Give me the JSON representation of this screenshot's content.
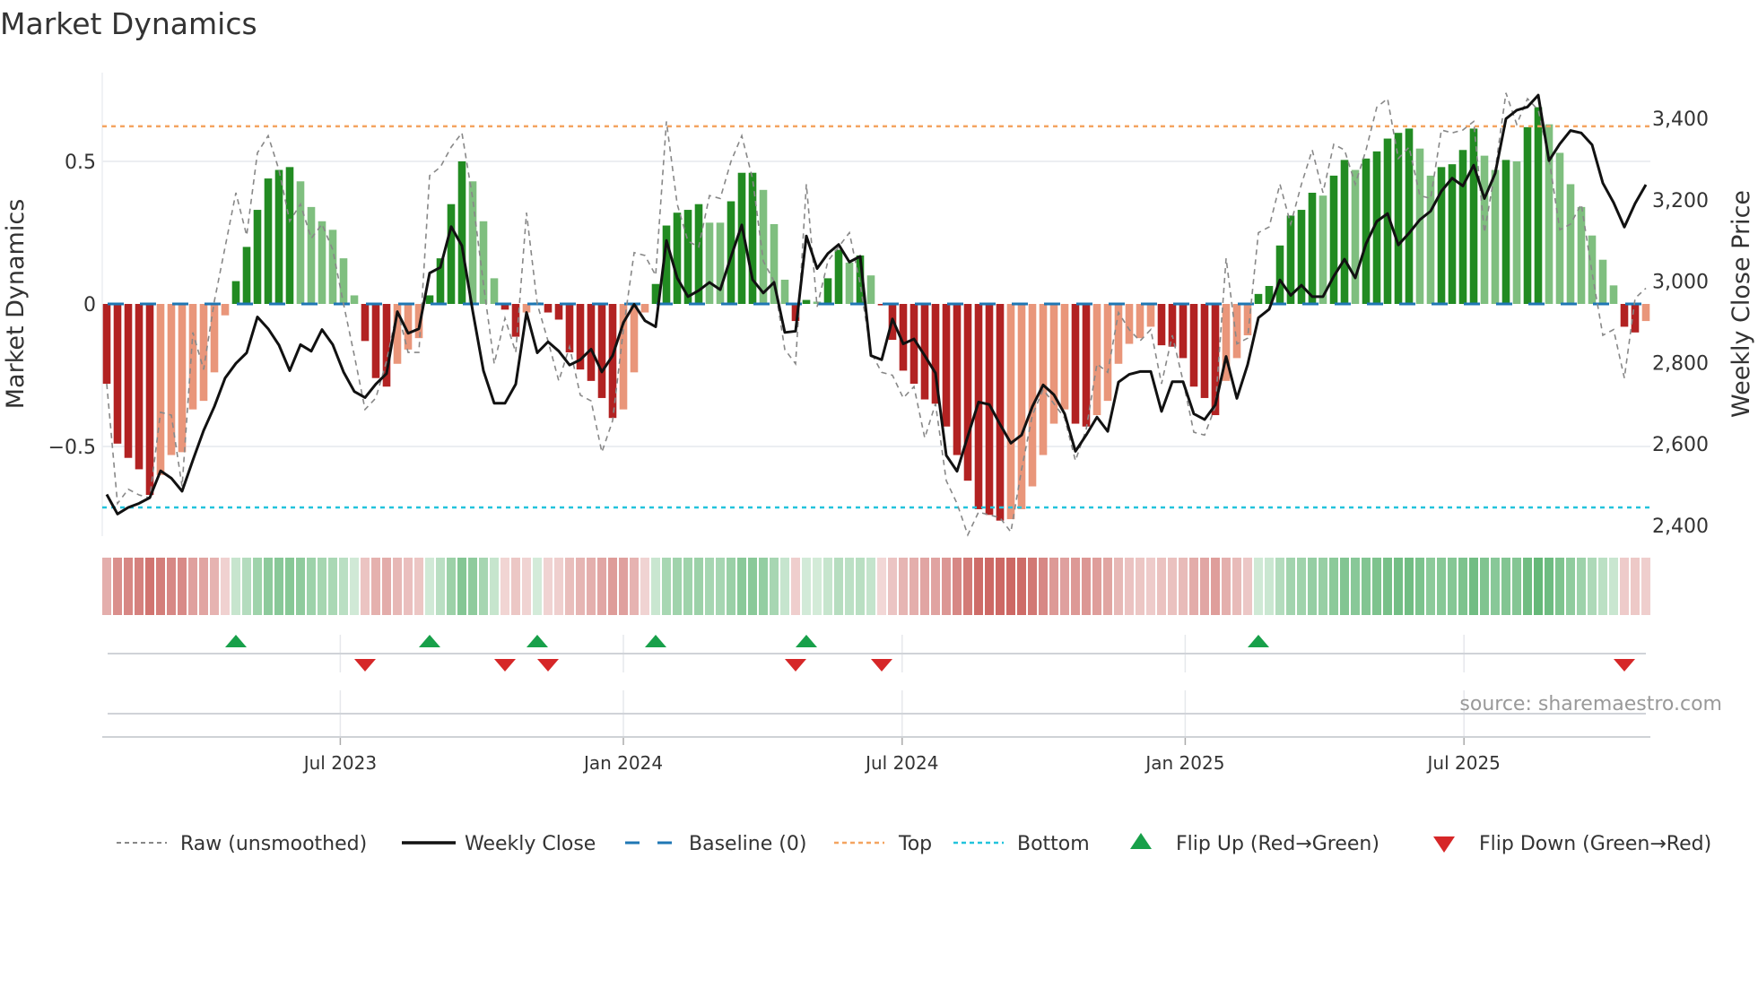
{
  "title": "Market Dynamics",
  "source": "source: sharemaestro.com",
  "chart_data": {
    "type": "bar",
    "title": "Market Dynamics",
    "ylabel": "Market Dynamics",
    "y2label": "Weekly Close Price",
    "ylim": [
      -0.82,
      0.78
    ],
    "y2lim": [
      2380,
      3515
    ],
    "yticks": [
      {
        "v": 0.5,
        "label": "0.5"
      },
      {
        "v": 0,
        "label": "0"
      },
      {
        "v": -0.5,
        "label": "−0.5"
      }
    ],
    "y2ticks": [
      {
        "v": 2400,
        "label": "2,400"
      },
      {
        "v": 2600,
        "label": "2,600"
      },
      {
        "v": 2800,
        "label": "2,800"
      },
      {
        "v": 3000,
        "label": "3,000"
      },
      {
        "v": 3200,
        "label": "3,200"
      },
      {
        "v": 3400,
        "label": "3,400"
      }
    ],
    "xticks": [
      {
        "week": 21.7,
        "label": "Jul 2023"
      },
      {
        "week": 48.0,
        "label": "Jan 2024"
      },
      {
        "week": 73.9,
        "label": "Jul 2024"
      },
      {
        "week": 100.2,
        "label": "Jan 2025"
      },
      {
        "week": 126.1,
        "label": "Jul 2025"
      }
    ],
    "top_level": 0.623,
    "bottom_level": -0.714,
    "baseline": 0,
    "market_dynamics": [
      -0.28,
      -0.49,
      -0.54,
      -0.58,
      -0.67,
      -0.6,
      -0.53,
      -0.52,
      -0.37,
      -0.34,
      -0.24,
      -0.04,
      0.08,
      0.2,
      0.33,
      0.44,
      0.47,
      0.48,
      0.43,
      0.34,
      0.29,
      0.26,
      0.16,
      0.03,
      -0.13,
      -0.26,
      -0.29,
      -0.21,
      -0.16,
      -0.12,
      0.03,
      0.16,
      0.35,
      0.5,
      0.43,
      0.29,
      0.09,
      -0.02,
      -0.115,
      -0.03,
      0.005,
      -0.03,
      -0.055,
      -0.17,
      -0.23,
      -0.27,
      -0.33,
      -0.4,
      -0.37,
      -0.24,
      -0.03,
      0.07,
      0.275,
      0.32,
      0.33,
      0.35,
      0.285,
      0.285,
      0.36,
      0.46,
      0.46,
      0.4,
      0.28,
      0.085,
      -0.06,
      0.014,
      0.008,
      0.09,
      0.19,
      0.145,
      0.17,
      0.1,
      -0.005,
      -0.126,
      -0.234,
      -0.28,
      -0.335,
      -0.35,
      -0.43,
      -0.53,
      -0.62,
      -0.72,
      -0.74,
      -0.76,
      -0.755,
      -0.72,
      -0.64,
      -0.53,
      -0.42,
      -0.37,
      -0.42,
      -0.43,
      -0.39,
      -0.34,
      -0.21,
      -0.14,
      -0.12,
      -0.08,
      -0.145,
      -0.15,
      -0.19,
      -0.29,
      -0.33,
      -0.39,
      -0.27,
      -0.19,
      -0.11,
      0.035,
      0.063,
      0.205,
      0.31,
      0.33,
      0.39,
      0.38,
      0.45,
      0.505,
      0.47,
      0.51,
      0.535,
      0.58,
      0.6,
      0.615,
      0.545,
      0.45,
      0.48,
      0.49,
      0.54,
      0.615,
      0.52,
      0.47,
      0.505,
      0.5,
      0.62,
      0.69,
      0.63,
      0.53,
      0.42,
      0.34,
      0.24,
      0.155,
      0.065,
      -0.08,
      -0.1,
      -0.06
    ],
    "strengthening": [
      1,
      1,
      1,
      1,
      1,
      0,
      0,
      0,
      0,
      0,
      0,
      0,
      1,
      1,
      1,
      1,
      1,
      1,
      0,
      0,
      0,
      0,
      0,
      0,
      1,
      1,
      1,
      0,
      0,
      0,
      1,
      1,
      1,
      1,
      0,
      0,
      0,
      1,
      1,
      0,
      1,
      1,
      1,
      1,
      1,
      1,
      1,
      1,
      0,
      0,
      0,
      1,
      1,
      1,
      1,
      1,
      0,
      0,
      1,
      1,
      1,
      0,
      0,
      0,
      1,
      1,
      0,
      1,
      1,
      0,
      1,
      0,
      1,
      1,
      1,
      1,
      1,
      1,
      1,
      1,
      1,
      1,
      1,
      1,
      0,
      0,
      0,
      0,
      0,
      0,
      1,
      1,
      0,
      0,
      0,
      0,
      0,
      0,
      1,
      1,
      1,
      1,
      1,
      1,
      0,
      0,
      0,
      1,
      1,
      1,
      1,
      1,
      1,
      0,
      1,
      1,
      0,
      1,
      1,
      1,
      1,
      1,
      0,
      0,
      1,
      1,
      1,
      1,
      0,
      0,
      1,
      0,
      1,
      1,
      0,
      0,
      0,
      0,
      0,
      0,
      0,
      1,
      1,
      0
    ],
    "raw": [
      -0.28,
      -0.7,
      -0.65,
      -0.67,
      -0.68,
      -0.38,
      -0.39,
      -0.64,
      -0.1,
      -0.23,
      0.01,
      0.2,
      0.39,
      0.24,
      0.53,
      0.59,
      0.47,
      0.29,
      0.35,
      0.23,
      0.28,
      0.19,
      0.0,
      -0.18,
      -0.37,
      -0.33,
      -0.2,
      -0.02,
      -0.17,
      -0.17,
      0.45,
      0.48,
      0.55,
      0.6,
      0.37,
      0.07,
      -0.21,
      -0.05,
      -0.17,
      0.32,
      0.0,
      -0.13,
      -0.27,
      -0.15,
      -0.32,
      -0.34,
      -0.52,
      -0.41,
      -0.09,
      0.18,
      0.17,
      0.1,
      0.64,
      0.35,
      0.22,
      0.2,
      0.38,
      0.37,
      0.5,
      0.59,
      0.44,
      0.15,
      0.08,
      -0.16,
      -0.21,
      0.42,
      -0.01,
      0.15,
      0.2,
      0.25,
      0.07,
      -0.17,
      -0.24,
      -0.25,
      -0.33,
      -0.29,
      -0.47,
      -0.35,
      -0.62,
      -0.7,
      -0.81,
      -0.73,
      -0.74,
      -0.75,
      -0.8,
      -0.58,
      -0.39,
      -0.3,
      -0.35,
      -0.4,
      -0.55,
      -0.44,
      -0.21,
      -0.24,
      -0.03,
      -0.09,
      -0.13,
      -0.09,
      -0.28,
      -0.11,
      -0.27,
      -0.45,
      -0.46,
      -0.36,
      0.16,
      -0.14,
      -0.12,
      0.25,
      0.27,
      0.42,
      0.28,
      0.42,
      0.54,
      0.39,
      0.56,
      0.54,
      0.42,
      0.54,
      0.69,
      0.72,
      0.51,
      0.55,
      0.38,
      0.37,
      0.61,
      0.6,
      0.61,
      0.64,
      0.25,
      0.47,
      0.74,
      0.63,
      0.72,
      0.68,
      0.51,
      0.26,
      0.28,
      0.35,
      0.11,
      -0.11,
      -0.09,
      -0.26,
      0.02,
      0.055
    ],
    "weekly_close": [
      2476,
      2428,
      2444,
      2454,
      2468,
      2534,
      2516,
      2484,
      2560,
      2633,
      2692,
      2762,
      2798,
      2824,
      2912,
      2883,
      2843,
      2780,
      2844,
      2828,
      2881,
      2844,
      2777,
      2729,
      2714,
      2747,
      2773,
      2925,
      2872,
      2883,
      3020,
      3034,
      3134,
      3087,
      2927,
      2780,
      2700,
      2700,
      2747,
      2923,
      2824,
      2851,
      2828,
      2794,
      2807,
      2833,
      2777,
      2817,
      2898,
      2943,
      2903,
      2888,
      3100,
      3008,
      2962,
      2977,
      2997,
      2979,
      3060,
      3138,
      3004,
      2971,
      2997,
      2874,
      2877,
      3111,
      3031,
      3068,
      3090,
      3047,
      3061,
      2817,
      2807,
      2907,
      2846,
      2858,
      2817,
      2774,
      2572,
      2533,
      2619,
      2703,
      2697,
      2648,
      2602,
      2622,
      2692,
      2745,
      2721,
      2674,
      2582,
      2622,
      2666,
      2631,
      2752,
      2771,
      2778,
      2778,
      2680,
      2753,
      2753,
      2674,
      2660,
      2696,
      2815,
      2712,
      2795,
      2910,
      2931,
      3003,
      2965,
      2990,
      2962,
      2962,
      3012,
      3054,
      3008,
      3092,
      3147,
      3166,
      3089,
      3118,
      3151,
      3172,
      3221,
      3253,
      3234,
      3285,
      3203,
      3265,
      3399,
      3420,
      3428,
      3457,
      3296,
      3337,
      3370,
      3364,
      3335,
      3241,
      3193,
      3133,
      3191,
      3237
    ],
    "flip_up_weeks": [
      13,
      31,
      41,
      52,
      66,
      108
    ],
    "flip_down_weeks": [
      25,
      38,
      42,
      65,
      73,
      142
    ],
    "colors": {
      "dark_red": "#b22222",
      "light_red": "#e9967a",
      "dark_green": "#228b22",
      "light_green": "#7fbf7f",
      "baseline": "#1f77b4",
      "top": "#f4a460",
      "bottom": "#22c3dc",
      "raw": "#888888",
      "close": "#111111",
      "flip_up": "#18a04a",
      "flip_down": "#d62728"
    },
    "legend": {
      "placement": "bottom",
      "raw": "Raw (unsmoothed)",
      "close": "Weekly Close",
      "baseline": "Baseline (0)",
      "top": "Top",
      "bottom": "Bottom",
      "flip_up": "Flip Up (Red→Green)",
      "flip_down": "Flip Down (Green→Red)"
    }
  }
}
